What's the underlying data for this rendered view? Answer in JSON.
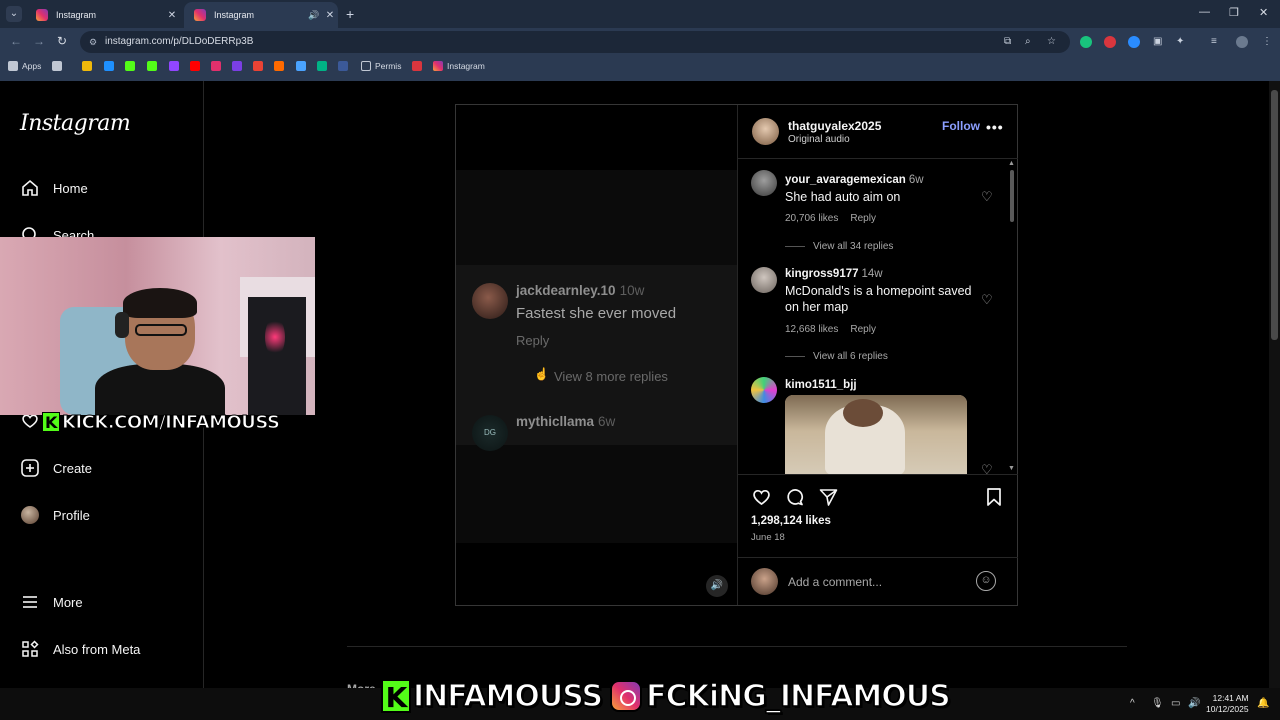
{
  "browser": {
    "tabs": [
      {
        "title": "Instagram",
        "active": false
      },
      {
        "title": "Instagram",
        "active": true
      }
    ],
    "url": "instagram.com/p/DLDoDERRp3B",
    "bookmarks": [
      {
        "label": "Apps"
      },
      {
        "label": "Permis"
      },
      {
        "label": "Instagram"
      }
    ]
  },
  "sidebar": {
    "logo": "Instagram",
    "items": [
      {
        "label": "Home",
        "icon": "home-icon"
      },
      {
        "label": "Search",
        "icon": "search-icon"
      },
      {
        "label": "Create",
        "icon": "create-icon"
      },
      {
        "label": "Profile",
        "icon": "profile-avatar"
      },
      {
        "label": "More",
        "icon": "menu-icon"
      },
      {
        "label": "Also from Meta",
        "icon": "meta-grid-icon"
      }
    ]
  },
  "overlay": {
    "kick_small": "KICK.COM/INFAMOUSS",
    "kick_letter": "K",
    "bottom_kick": "INFAMOUSS",
    "bottom_ig": "FCKiNG_INFAMOUS"
  },
  "video": {
    "comments": [
      {
        "user": "jackdearnley.10",
        "time": "10w",
        "text": "Fastest she ever moved",
        "reply": "Reply",
        "view_more": "View 8 more replies"
      },
      {
        "user": "mythicllama",
        "time": "6w"
      }
    ]
  },
  "post": {
    "owner": "thatguyalex2025",
    "subtitle": "Original audio",
    "follow_label": "Follow",
    "comments": [
      {
        "user": "your_avaragemexican",
        "time": "6w",
        "text": "She had auto aim on",
        "likes": "20,706 likes",
        "reply": "Reply",
        "view_all": "View all 34 replies"
      },
      {
        "user": "kingross9177",
        "time": "14w",
        "text": "McDonald's is a homepoint saved on her map",
        "likes": "12,668 likes",
        "reply": "Reply",
        "view_all": "View all 6 replies"
      },
      {
        "user": "kimo1511_bjj",
        "time": ""
      }
    ],
    "likes": "1,298,124 likes",
    "date": "June 18",
    "comment_placeholder": "Add a comment..."
  },
  "page": {
    "more_from": "More"
  },
  "taskbar": {
    "time": "12:41 AM",
    "date": "10/12/2025"
  },
  "colors": {
    "follow": "#8c9fff",
    "kick_green": "#53fc18",
    "chrome_bg": "#2b3a52"
  }
}
